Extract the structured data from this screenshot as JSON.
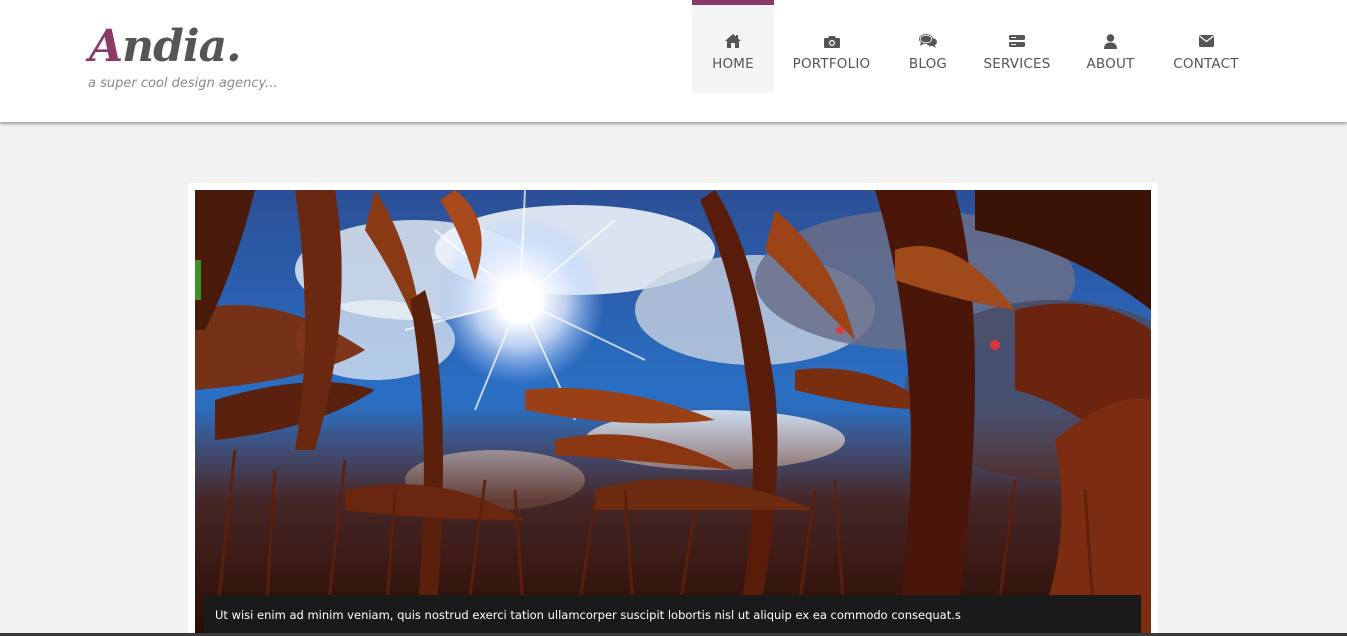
{
  "brand": {
    "logo_first_letter": "A",
    "logo_rest": "ndia.",
    "tagline": "a super cool design agency...",
    "accent_color": "#8b3a67"
  },
  "nav": {
    "items": [
      {
        "label": "HOME",
        "icon": "home-icon",
        "active": true
      },
      {
        "label": "PORTFOLIO",
        "icon": "camera-icon",
        "active": false
      },
      {
        "label": "BLOG",
        "icon": "comments-icon",
        "active": false
      },
      {
        "label": "SERVICES",
        "icon": "server-icon",
        "active": false
      },
      {
        "label": "ABOUT",
        "icon": "user-icon",
        "active": false
      },
      {
        "label": "CONTACT",
        "icon": "envelope-icon",
        "active": false
      }
    ]
  },
  "slider": {
    "image": "corn-field-sun-icon",
    "caption": "Ut wisi enim ad minim veniam, quis nostrud exerci tation ullamcorper suscipit lobortis nisl ut aliquip ex ea commodo consequat.s"
  }
}
